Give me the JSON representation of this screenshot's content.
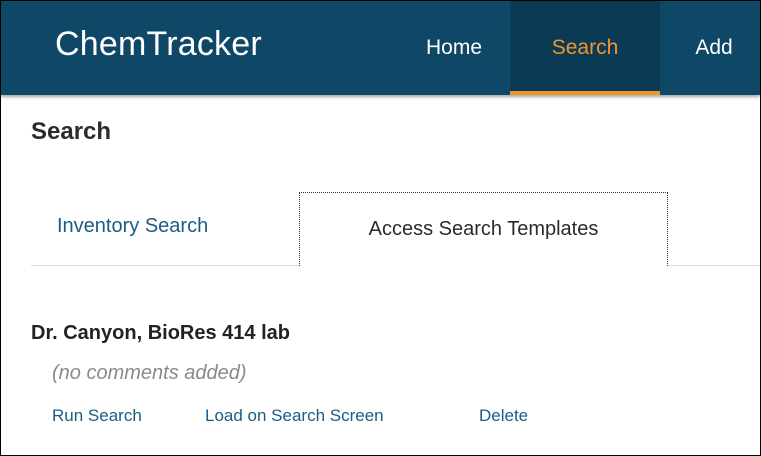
{
  "navbar": {
    "brand": "ChemTracker",
    "items": [
      {
        "label": "Home"
      },
      {
        "label": "Search"
      },
      {
        "label": "Add"
      }
    ],
    "active_color": "#f0952e",
    "background_color": "#0f4766"
  },
  "page": {
    "title": "Search"
  },
  "tabs": [
    {
      "label": "Inventory Search"
    },
    {
      "label": "Access Search Templates"
    }
  ],
  "template": {
    "name": "Dr. Canyon, BioRes 414 lab",
    "comment": "(no comments added)",
    "actions": {
      "run": "Run Search",
      "load": "Load on Search Screen",
      "delete": "Delete"
    }
  }
}
